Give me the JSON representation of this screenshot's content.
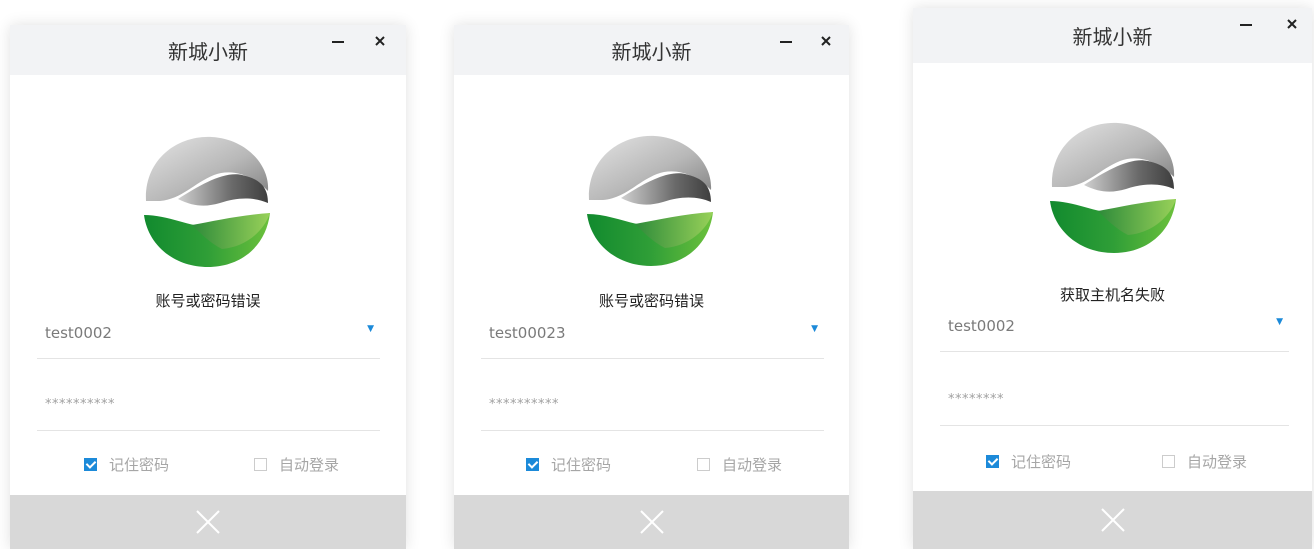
{
  "windows": [
    {
      "title": "新城小新",
      "error": "账号或密码错误",
      "username": "test0002",
      "password": "**********",
      "remember_label": "记住密码",
      "remember_checked": true,
      "auto_label": "自动登录",
      "auto_checked": false
    },
    {
      "title": "新城小新",
      "error": "账号或密码错误",
      "username": "test00023",
      "password": "**********",
      "remember_label": "记住密码",
      "remember_checked": true,
      "auto_label": "自动登录",
      "auto_checked": false
    },
    {
      "title": "新城小新",
      "error": "获取主机名失败",
      "username": "test0002",
      "password": "********",
      "remember_label": "记住密码",
      "remember_checked": true,
      "auto_label": "自动登录",
      "auto_checked": false
    }
  ],
  "icons": {
    "minimize": "minimize-icon",
    "close": "close-icon",
    "dropdown": "dropdown-arrow-icon",
    "login": "close-x-icon",
    "logo": "xincheng-logo"
  },
  "colors": {
    "accent": "#1c8ad9",
    "titlebar_bg": "#f2f3f5",
    "footer_bg": "#d8d8d8",
    "logo_green": "#3aa83a",
    "logo_gray": "#a0a0a0"
  }
}
